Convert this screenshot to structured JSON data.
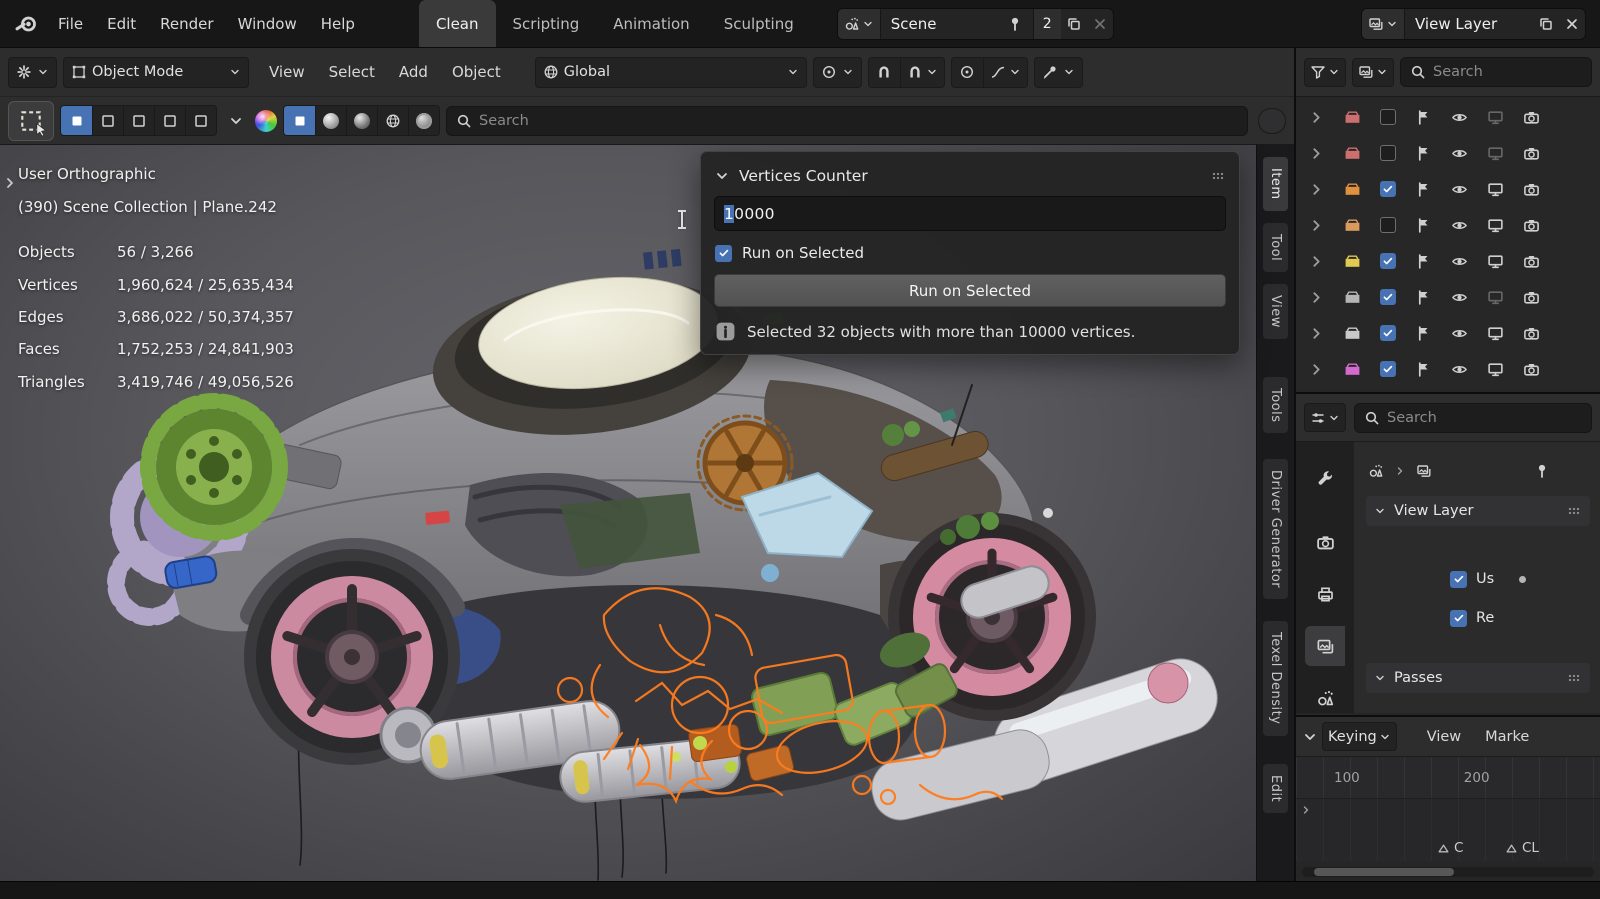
{
  "topbar": {
    "menus": [
      "File",
      "Edit",
      "Render",
      "Window",
      "Help"
    ],
    "workspace_tabs": [
      {
        "label": "Clean",
        "active": true
      },
      {
        "label": "Scripting",
        "active": false
      },
      {
        "label": "Animation",
        "active": false
      },
      {
        "label": "Sculpting",
        "active": false
      }
    ],
    "scene_selector": {
      "value": "Scene",
      "users_count": "2"
    },
    "view_layer_selector": {
      "value": "View Layer"
    }
  },
  "viewport_header": {
    "mode_selector": "Object Mode",
    "menus": [
      "View",
      "Select",
      "Add",
      "Object"
    ],
    "orientation": "Global",
    "search_placeholder": "Search"
  },
  "viewport": {
    "view_label": "User Orthographic",
    "context_label": "(390) Scene Collection | Plane.242",
    "stats": [
      {
        "label": "Objects",
        "value": "56 / 3,266"
      },
      {
        "label": "Vertices",
        "value": "1,960,624 / 25,635,434"
      },
      {
        "label": "Edges",
        "value": "3,686,022 / 50,374,357"
      },
      {
        "label": "Faces",
        "value": "1,752,253 / 24,841,903"
      },
      {
        "label": "Triangles",
        "value": "3,419,746 / 49,056,526"
      }
    ],
    "sidebar_tabs": [
      "Item",
      "Tool",
      "View",
      "Tools",
      "Driver Generator",
      "Texel Density",
      "Edit"
    ]
  },
  "vertices_counter": {
    "title": "Vertices Counter",
    "threshold_value": "10000",
    "checkbox_label": "Run on Selected",
    "button_label": "Run on Selected",
    "result_text": "Selected 32 objects with more than 10000 vertices."
  },
  "outliner": {
    "search_placeholder": "Search",
    "rows": [
      {
        "collection_color": "#cb6f6f",
        "checked": false,
        "screen_dim": true
      },
      {
        "collection_color": "#cb6f6f",
        "checked": false,
        "screen_dim": true
      },
      {
        "collection_color": "#e0913f",
        "checked": true,
        "screen_dim": false
      },
      {
        "collection_color": "#d89a5f",
        "checked": false,
        "screen_dim": false
      },
      {
        "collection_color": "#e2c94f",
        "checked": true,
        "screen_dim": false
      },
      {
        "collection_color": "#b5b5b5",
        "checked": true,
        "screen_dim": true
      },
      {
        "collection_color": "#c9c9c9",
        "checked": true,
        "screen_dim": false
      },
      {
        "collection_color": "#d36bcf",
        "checked": true,
        "screen_dim": false
      }
    ]
  },
  "properties": {
    "search_placeholder": "Search",
    "view_layer_panel": {
      "title": "View Layer",
      "options": [
        {
          "label": "Us",
          "checked": true,
          "decorator": true
        },
        {
          "label": "Re",
          "checked": true,
          "decorator": false
        }
      ]
    },
    "passes_panel": {
      "title": "Passes"
    }
  },
  "timeline": {
    "keying_label": "Keying",
    "view_label": "View",
    "marker_label": "Marke",
    "frame_ticks": [
      "100",
      "200"
    ],
    "markers": [
      {
        "label": "C"
      },
      {
        "label": "CL"
      }
    ]
  },
  "colors": {
    "accent": "#4772b3",
    "selection_outline": "#ff7c1e"
  }
}
